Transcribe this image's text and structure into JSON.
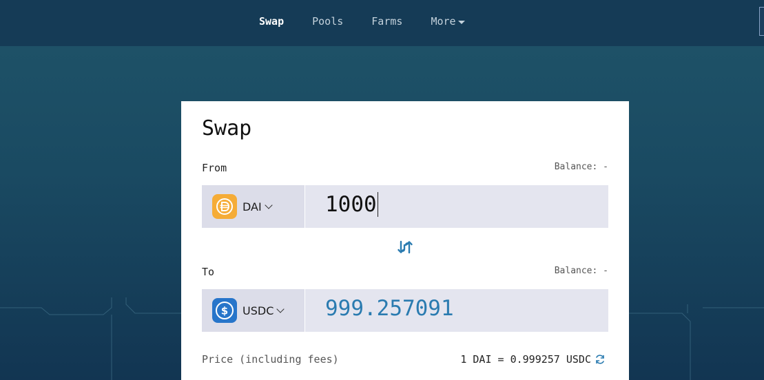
{
  "nav": {
    "items": [
      {
        "label": "Swap",
        "active": true
      },
      {
        "label": "Pools",
        "active": false
      },
      {
        "label": "Farms",
        "active": false
      },
      {
        "label": "More",
        "active": false
      }
    ]
  },
  "swap": {
    "title": "Swap",
    "from": {
      "label": "From",
      "balance": "Balance: -",
      "token": "DAI",
      "token_icon": "dai-icon",
      "token_color": "#f5ac37",
      "amount": "1000"
    },
    "to": {
      "label": "To",
      "balance": "Balance: -",
      "token": "USDC",
      "token_icon": "usdc-icon",
      "token_color": "#2775ca",
      "amount": "999.257091"
    },
    "price": {
      "label": "Price (including fees)",
      "value": "1 DAI = 0.999257 USDC"
    }
  },
  "colors": {
    "accent": "#2a7bb0",
    "input_bg": "#e4e5ef",
    "header_bg": "#153b56"
  }
}
